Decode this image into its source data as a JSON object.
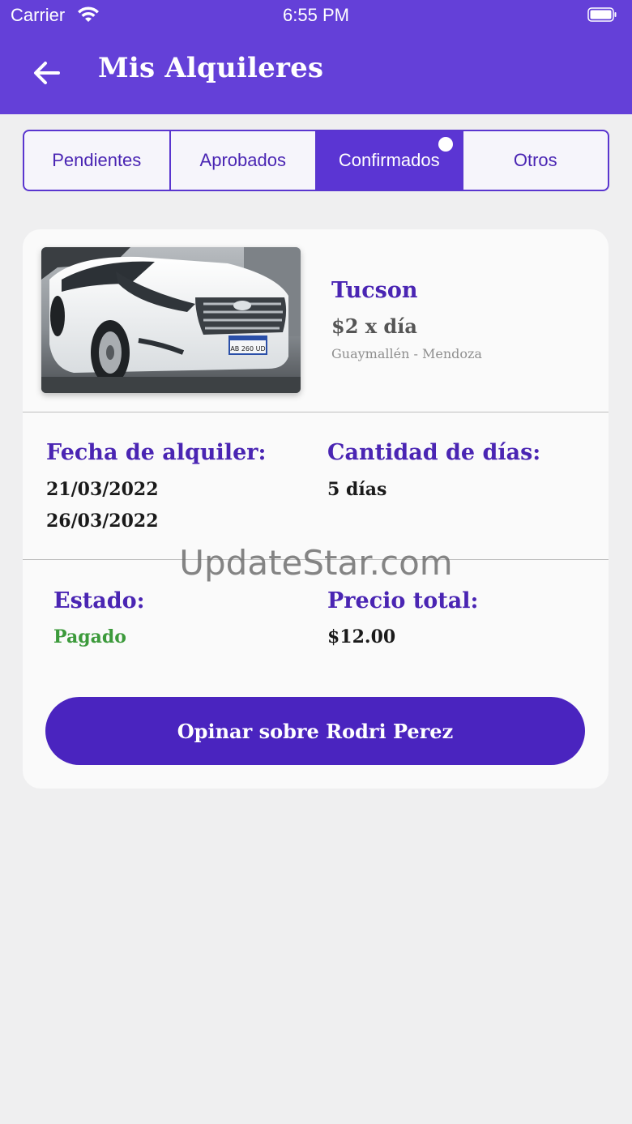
{
  "status_bar": {
    "carrier": "Carrier",
    "time": "6:55 PM"
  },
  "header": {
    "title": "Mis Alquileres",
    "back_icon": "arrow-left-icon",
    "background": "#6440d8"
  },
  "tabs": [
    {
      "label": "Pendientes",
      "active": false
    },
    {
      "label": "Aprobados",
      "active": false
    },
    {
      "label": "Confirmados",
      "active": true,
      "has_notification": true
    },
    {
      "label": "Otros",
      "active": false
    }
  ],
  "rental": {
    "car_name": "Tucson",
    "price_per_day": "$2 x día",
    "location": "Guaymallén - Mendoza",
    "plate": "AB 260 UD",
    "rental_date_label": "Fecha de alquiler:",
    "start_date": "21/03/2022",
    "end_date": "26/03/2022",
    "days_label": "Cantidad de días:",
    "days_value": "5 días",
    "status_label": "Estado:",
    "status_value": "Pagado",
    "total_label": "Precio total:",
    "total_value": "$12.00",
    "action_label": "Opinar sobre Rodri Perez"
  },
  "watermark": "UpdateStar.com",
  "colors": {
    "primary": "#4a24bf",
    "accent_text": "#4a25b3",
    "status_paid": "#3c9a3b"
  }
}
